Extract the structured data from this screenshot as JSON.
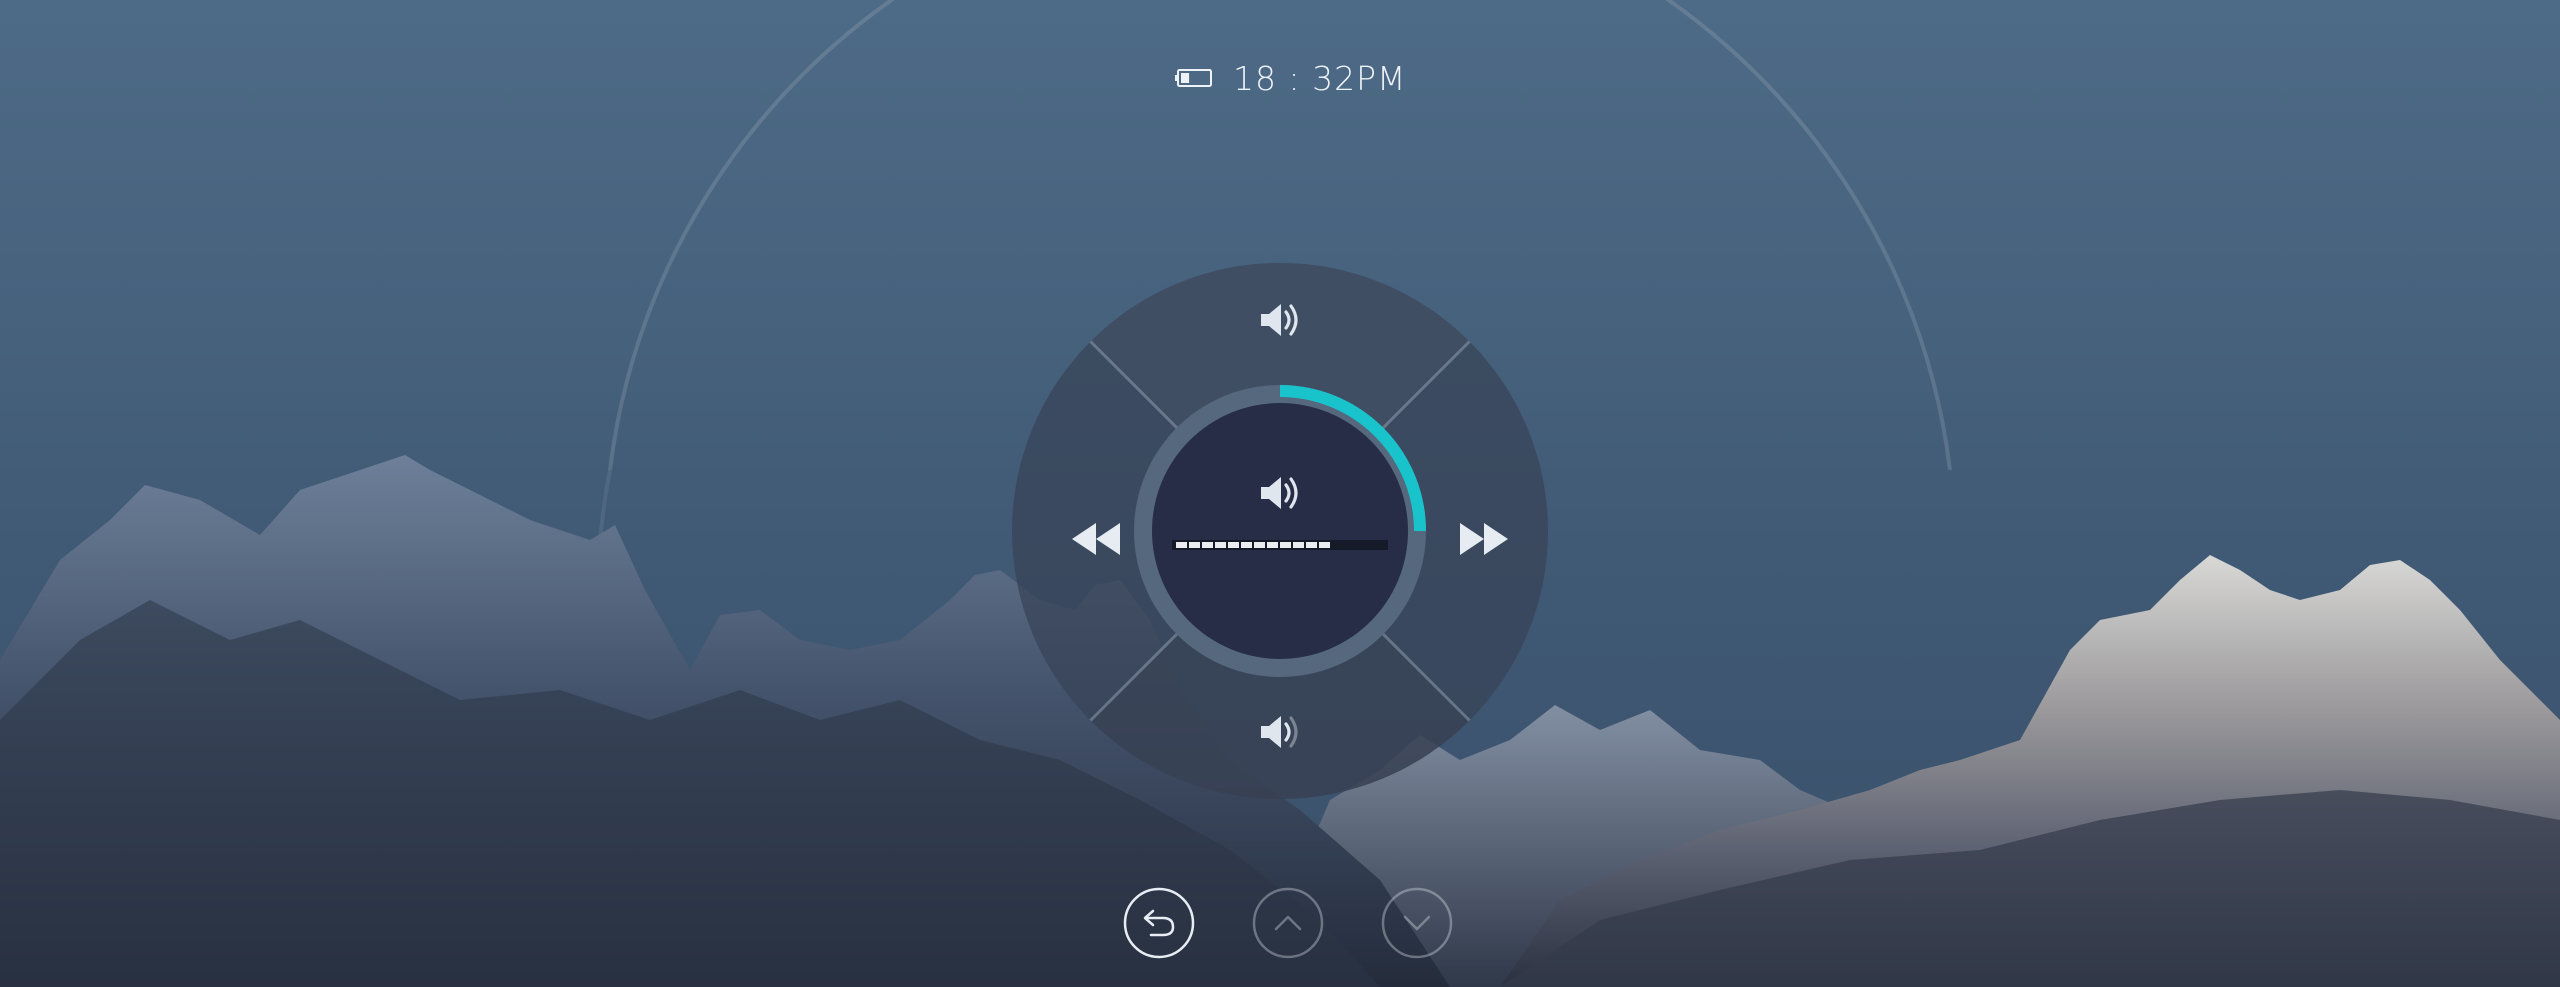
{
  "status_bar": {
    "time": "18 : 32PM",
    "battery_level": 0.3,
    "battery_icon": "battery-low-icon"
  },
  "volume_control": {
    "level": 0.25,
    "level_segments_filled": 12,
    "level_segments_total": 16,
    "center_icon": "volume-icon",
    "buttons": {
      "volume_up": {
        "icon": "volume-up-icon"
      },
      "volume_down": {
        "icon": "volume-down-icon"
      },
      "rewind": {
        "icon": "rewind-icon"
      },
      "fast_forward": {
        "icon": "fast-forward-icon"
      }
    }
  },
  "nav_buttons": [
    {
      "icon": "back-icon",
      "state": "active"
    },
    {
      "icon": "chevron-up-icon",
      "state": "dimmed"
    },
    {
      "icon": "chevron-down-icon",
      "state": "dimmed"
    }
  ],
  "colors": {
    "accent": "#19c3cc",
    "dial_center": "#272d46",
    "dial_ring": "#55677c",
    "dial_outer": "#3f4c60",
    "icon": "#d9e2ec"
  }
}
